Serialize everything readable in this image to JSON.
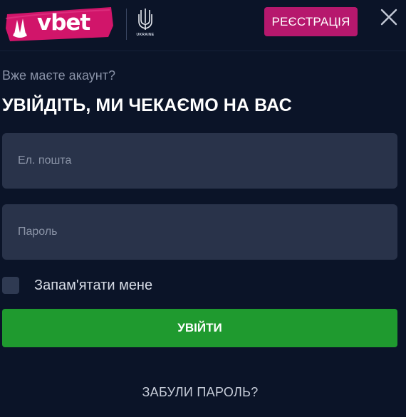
{
  "header": {
    "logo_text": "vbet",
    "emblem_caption": "UKRAINE",
    "register_label": "РЕЄСТРАЦІЯ",
    "close_icon": "close-icon"
  },
  "login": {
    "subtitle": "Вже маєте акаунт?",
    "title": "УВІЙДІТЬ, МИ ЧЕКАЄМО НА ВАС",
    "email_placeholder": "Ел. пошта",
    "password_placeholder": "Пароль",
    "remember_label": "Запам'ятати мене",
    "submit_label": "УВІЙТИ",
    "forgot_label": "ЗАБУЛИ ПАРОЛЬ?"
  },
  "colors": {
    "background": "#0b1428",
    "brand_pink": "#b6186d",
    "submit_green": "#1f9a2f",
    "field_bg": "#29334a"
  }
}
